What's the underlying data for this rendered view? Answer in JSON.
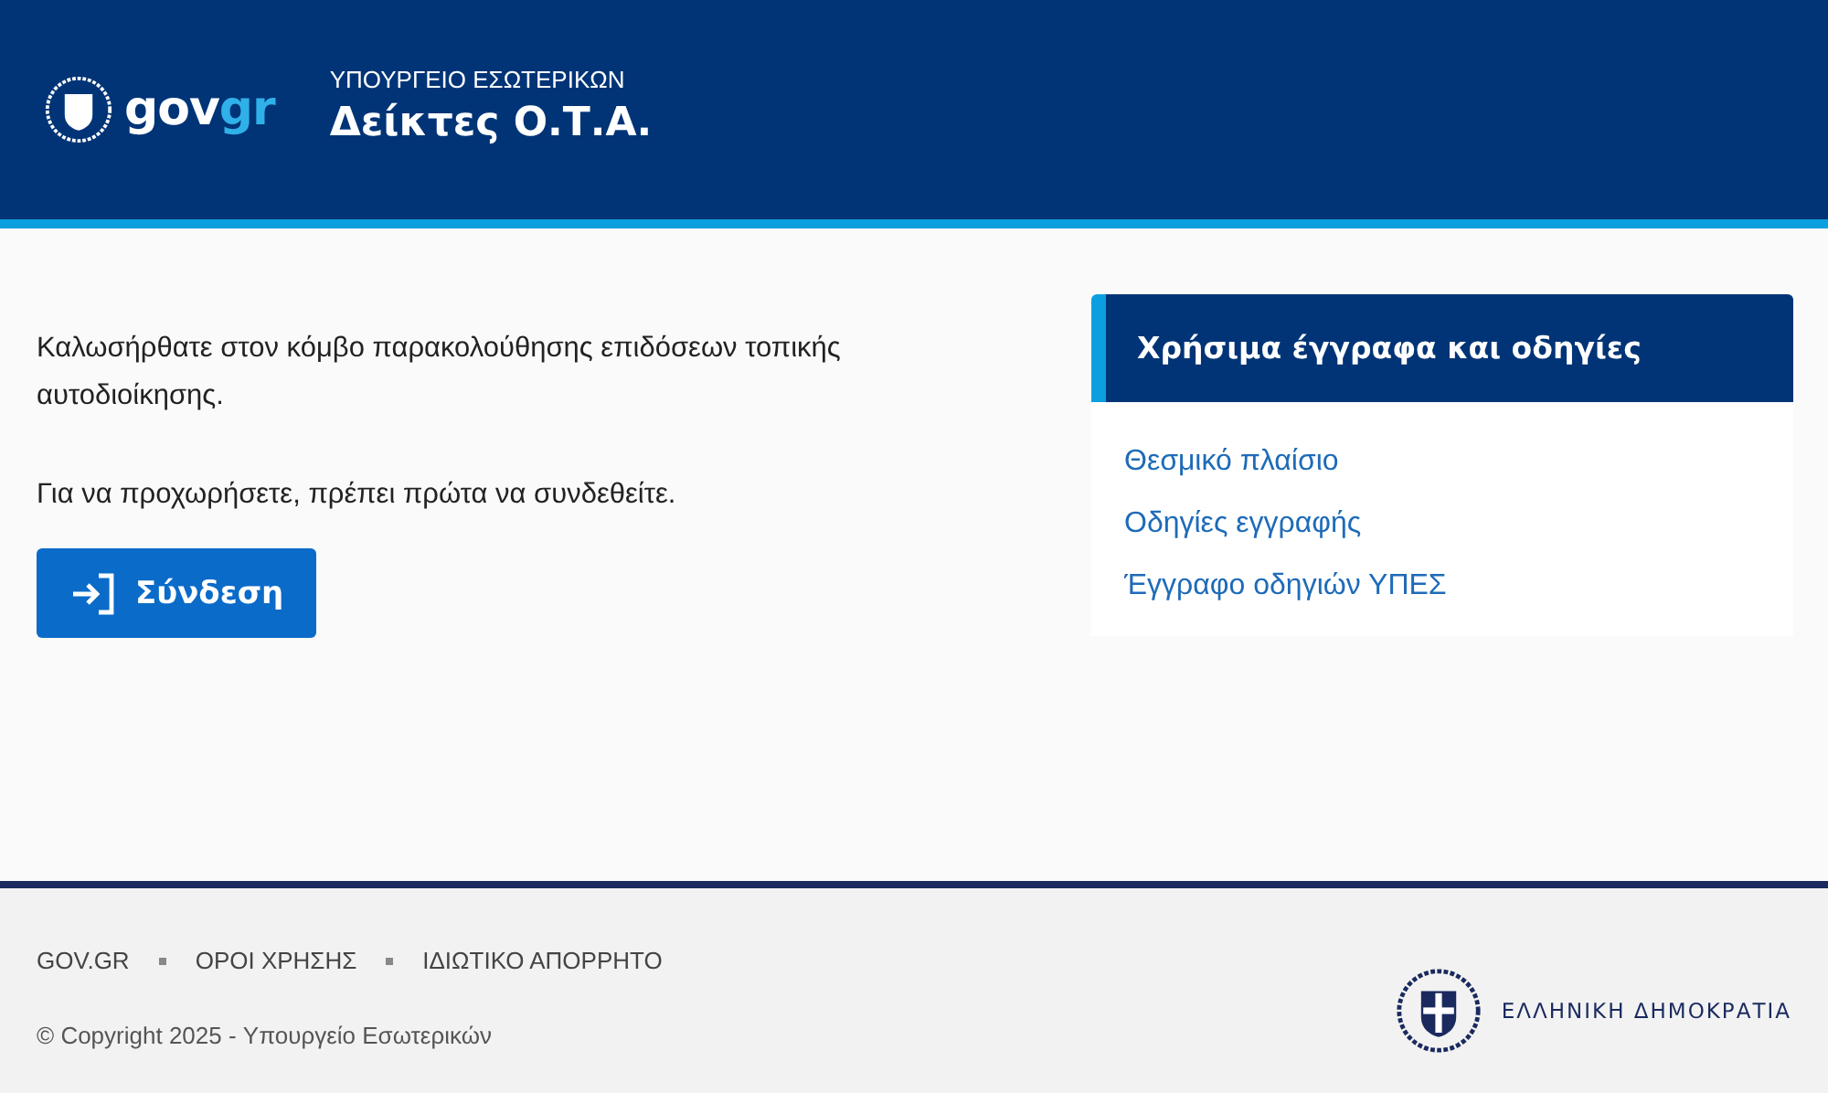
{
  "header": {
    "logo": {
      "part_1": "gov",
      "part_2": "gr"
    },
    "ministry": "ΥΠΟΥΡΓΕΙΟ ΕΣΩΤΕΡΙΚΩΝ",
    "title": "Δείκτες Ο.Τ.Α."
  },
  "main": {
    "welcome": "Καλωσήρθατε στον κόμβο παρακολούθησης επιδόσεων τοπικής αυτοδιοίκησης.",
    "instruction": "Για να προχωρήσετε, πρέπει πρώτα να συνδεθείτε.",
    "login_button": "Σύνδεση"
  },
  "sidebar": {
    "title": "Χρήσιμα έγγραφα και οδηγίες",
    "links": [
      "Θεσμικό πλαίσιο",
      "Οδηγίες εγγραφής",
      "Έγγραφο οδηγιών ΥΠΕΣ"
    ]
  },
  "footer": {
    "links": [
      "GOV.GR",
      "ΟΡΟΙ ΧΡΗΣΗΣ",
      "ΙΔΙΩΤΙΚΟ ΑΠΟΡΡΗΤΟ"
    ],
    "copyright": "© Copyright 2025 - Υπουργείο Εσωτερικών",
    "republic": "ΕΛΛΗΝΙΚΗ ΔΗΜΟΚΡΑΤΙΑ"
  }
}
